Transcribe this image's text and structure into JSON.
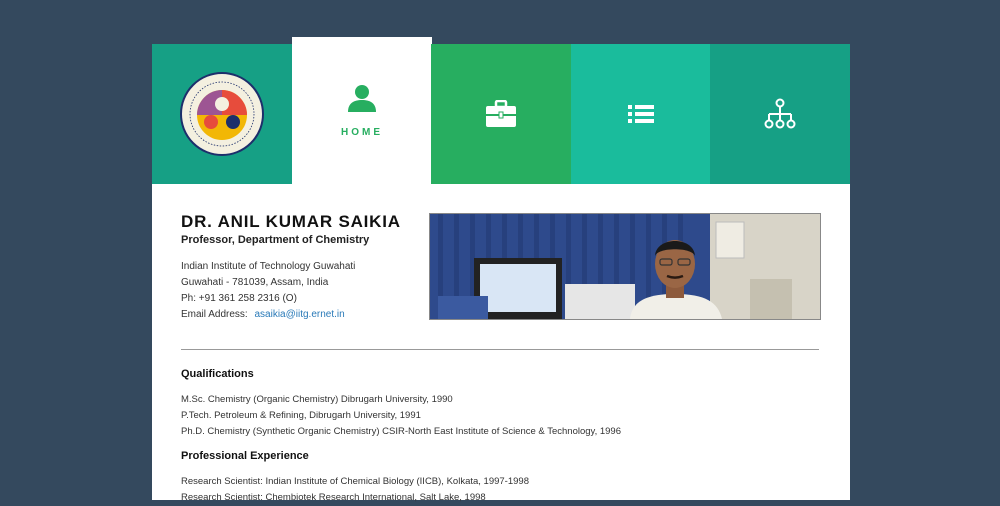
{
  "nav": {
    "logo_name": "Indian Institute of Technology Guwahati",
    "home_label": "HOME",
    "tabs": [
      {
        "icon": "person-icon",
        "label": "HOME"
      },
      {
        "icon": "briefcase-icon"
      },
      {
        "icon": "list-icon"
      },
      {
        "icon": "sitemap-icon"
      }
    ],
    "colors": {
      "tile1": "#16a085",
      "tile2": "#27ae60",
      "tile3": "#1abc9c",
      "tile4": "#16a085",
      "accent": "#27ae60"
    }
  },
  "profile": {
    "name": "DR. ANIL KUMAR SAIKIA",
    "title": "Professor, Department of Chemistry",
    "institute": "Indian Institute of Technology Guwahati",
    "city": "Guwahati - 781039, Assam, India",
    "phone": "Ph: +91 361 258 2316 (O)",
    "email_label": "Email Address:",
    "email": "asaikia@iitg.ernet.in"
  },
  "qualifications": {
    "heading": "Qualifications",
    "items": [
      "M.Sc. Chemistry (Organic Chemistry) Dibrugarh University, 1990",
      "P.Tech. Petroleum & Refining, Dibrugarh University, 1991",
      "Ph.D. Chemistry (Synthetic Organic Chemistry) CSIR-North East Institute of Science & Technology, 1996"
    ]
  },
  "experience": {
    "heading": "Professional Experience",
    "items": [
      "Research Scientist: Indian Institute of Chemical Biology (IICB), Kolkata, 1997-1998",
      "Research Scientist: Chembiotek Research International, Salt Lake, 1998"
    ]
  }
}
